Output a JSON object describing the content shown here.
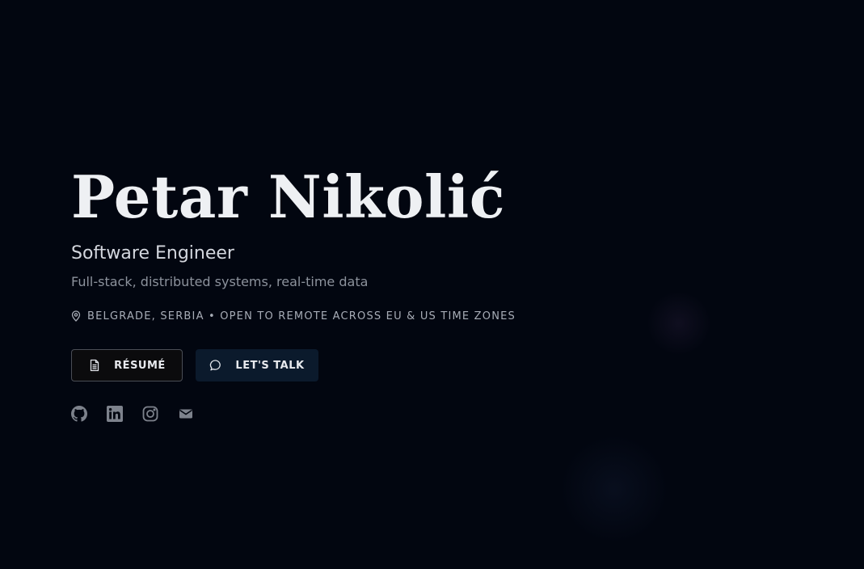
{
  "hero": {
    "name": "Petar Nikolić",
    "role": "Software Engineer",
    "tagline": "Full-stack, distributed systems, real-time data",
    "location": "BELGRADE, SERBIA • OPEN TO REMOTE ACROSS EU & US TIME ZONES"
  },
  "actions": {
    "resume_label": "RÉSUMÉ",
    "talk_label": "LET'S TALK"
  },
  "socials": [
    {
      "icon": "github-icon"
    },
    {
      "icon": "linkedin-icon"
    },
    {
      "icon": "instagram-icon"
    },
    {
      "icon": "mail-icon"
    }
  ],
  "colors": {
    "background": "#020610",
    "text": "#eef0f3",
    "muted": "#8c929c",
    "icon": "#7d828c",
    "talk_button": "#0b1a2c"
  }
}
